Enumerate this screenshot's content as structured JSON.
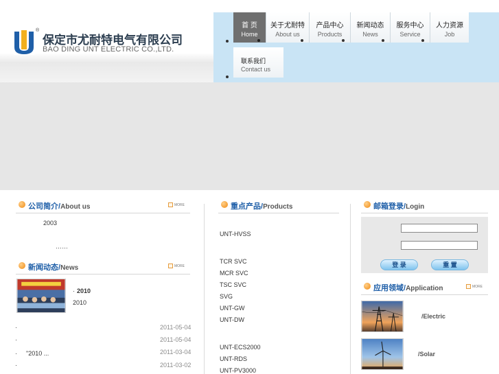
{
  "header": {
    "company_cn": "保定市尤耐特电气有限公司",
    "company_en": "BAO DING UNT ELECTRIC CO.,LTD.",
    "registered_mark": "®",
    "nav": [
      {
        "cn": "首 页",
        "en": "Home"
      },
      {
        "cn": "关于尤耐特",
        "en": "About us"
      },
      {
        "cn": "产品中心",
        "en": "Products"
      },
      {
        "cn": "新闻动态",
        "en": "News"
      },
      {
        "cn": "服务中心",
        "en": "Service"
      },
      {
        "cn": "人力资源",
        "en": "Job"
      }
    ],
    "contact": {
      "cn": "联系我们",
      "en": "Contact us"
    }
  },
  "about": {
    "title_cn": "公司简介",
    "title_en": "About us",
    "more": "MORE",
    "year": "2003",
    "ellipsis": "……"
  },
  "news": {
    "title_cn": "新闻动态",
    "title_en": "News",
    "more": "MORE",
    "featured_title": "2010",
    "featured_sub": "2010",
    "items": [
      {
        "text": "",
        "date": "2011-05-04"
      },
      {
        "text": "",
        "date": "2011-05-04"
      },
      {
        "text": "\"2010       ...",
        "date": "2011-03-04"
      },
      {
        "text": "",
        "date": "2011-03-02"
      }
    ]
  },
  "products": {
    "title_cn": "重点产品",
    "title_en": "Products",
    "items": [
      "UNT-HVSS",
      "TCR SVC",
      "MCR SVC",
      "TSC SVC",
      "SVG",
      "UNT-GW",
      "UNT-DW",
      "UNT-ECS2000",
      "UNT-RDS",
      "UNT-PV3000"
    ]
  },
  "login": {
    "title_cn": "邮箱登录",
    "title_en": "Login",
    "login_label": "登 录",
    "reset_label": "重 置"
  },
  "application": {
    "title_cn": "应用领域",
    "title_en": "Application",
    "more": "MORE",
    "items": [
      {
        "label": "/Electric"
      },
      {
        "label": "/Solar"
      }
    ]
  },
  "colors": {
    "nav_band": "#c9e4f5",
    "banner": "#e6e6e6",
    "section_title": "#1f5fa8",
    "active_nav": "#6f6f6f"
  }
}
